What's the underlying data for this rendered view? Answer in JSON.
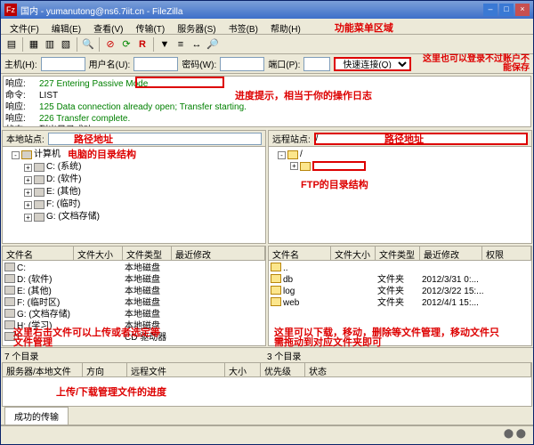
{
  "window": {
    "title": "国内 - yumanutong@ns6.7iit.cn - FileZilla"
  },
  "menu": {
    "file": "文件(F)",
    "edit": "编辑(E)",
    "view": "查看(V)",
    "transfer": "传输(T)",
    "server": "服务器(S)",
    "bookmark": "书签(B)",
    "help": "帮助(H)"
  },
  "anno": {
    "menubar": "功能菜单区域",
    "quick_right": "这里也可以登录不过账户不能保存",
    "log": "进度提示，相当于你的操作日志",
    "local_path": "路径地址",
    "remote_path": "路径地址",
    "local_tree": "电脑的目录结构",
    "remote_tree": "FTP的目录结构",
    "local_files": "这里右击文件可以上传或者选定等文件管理",
    "remote_files": "这里可以下载，移动，删除等文件管理，移动文件只需拖动到对应文件夹即可",
    "queue": "上传/下载管理文件的进度"
  },
  "quick": {
    "host": "主机(H):",
    "user": "用户名(U):",
    "pass": "密码(W):",
    "port": "端口(P):",
    "connect": "快速连接(Q)"
  },
  "log": [
    {
      "k": "响应:",
      "v": "227 Entering Passive Mode",
      "cls": "log-green"
    },
    {
      "k": "命令:",
      "v": "LIST",
      "cls": ""
    },
    {
      "k": "响应:",
      "v": "125 Data connection already open; Transfer starting.",
      "cls": "log-green"
    },
    {
      "k": "响应:",
      "v": "226 Transfer complete.",
      "cls": "log-green"
    },
    {
      "k": "状态:",
      "v": "列出目录成功",
      "cls": ""
    }
  ],
  "local": {
    "site_label": "本地站点:",
    "root": "计算机",
    "drives": [
      "C: (系统)",
      "D: (软件)",
      "E: (其他)",
      "F: (临时)",
      "G: (文档存储)"
    ]
  },
  "remote": {
    "site_label": "远程站点:",
    "path": "/"
  },
  "cols": {
    "name": "文件名",
    "size": "文件大小",
    "type": "文件类型",
    "date": "最近修改",
    "perm": "权限"
  },
  "local_files": [
    {
      "n": "C:",
      "t": "本地磁盘"
    },
    {
      "n": "D: (软件)",
      "t": "本地磁盘"
    },
    {
      "n": "E: (其他)",
      "t": "本地磁盘"
    },
    {
      "n": "F: (临时区)",
      "t": "本地磁盘"
    },
    {
      "n": "G: (文档存储)",
      "t": "本地磁盘"
    },
    {
      "n": "H: (学习)",
      "t": "本地磁盘"
    },
    {
      "n": "I:",
      "t": "CD 驱动器"
    }
  ],
  "remote_files": [
    {
      "n": "..",
      "t": "",
      "d": ""
    },
    {
      "n": "db",
      "t": "文件夹",
      "d": "2012/3/31 0:..."
    },
    {
      "n": "log",
      "t": "文件夹",
      "d": "2012/3/22 15:..."
    },
    {
      "n": "web",
      "t": "文件夹",
      "d": "2012/4/1 15:..."
    }
  ],
  "status": {
    "local": "7 个目录",
    "remote": "3 个目录"
  },
  "queue_cols": {
    "server": "服务器/本地文件",
    "dir": "方向",
    "remote": "远程文件",
    "size": "大小",
    "prio": "优先级",
    "stat": "状态"
  },
  "tabs": {
    "complete": "成功的传输"
  }
}
